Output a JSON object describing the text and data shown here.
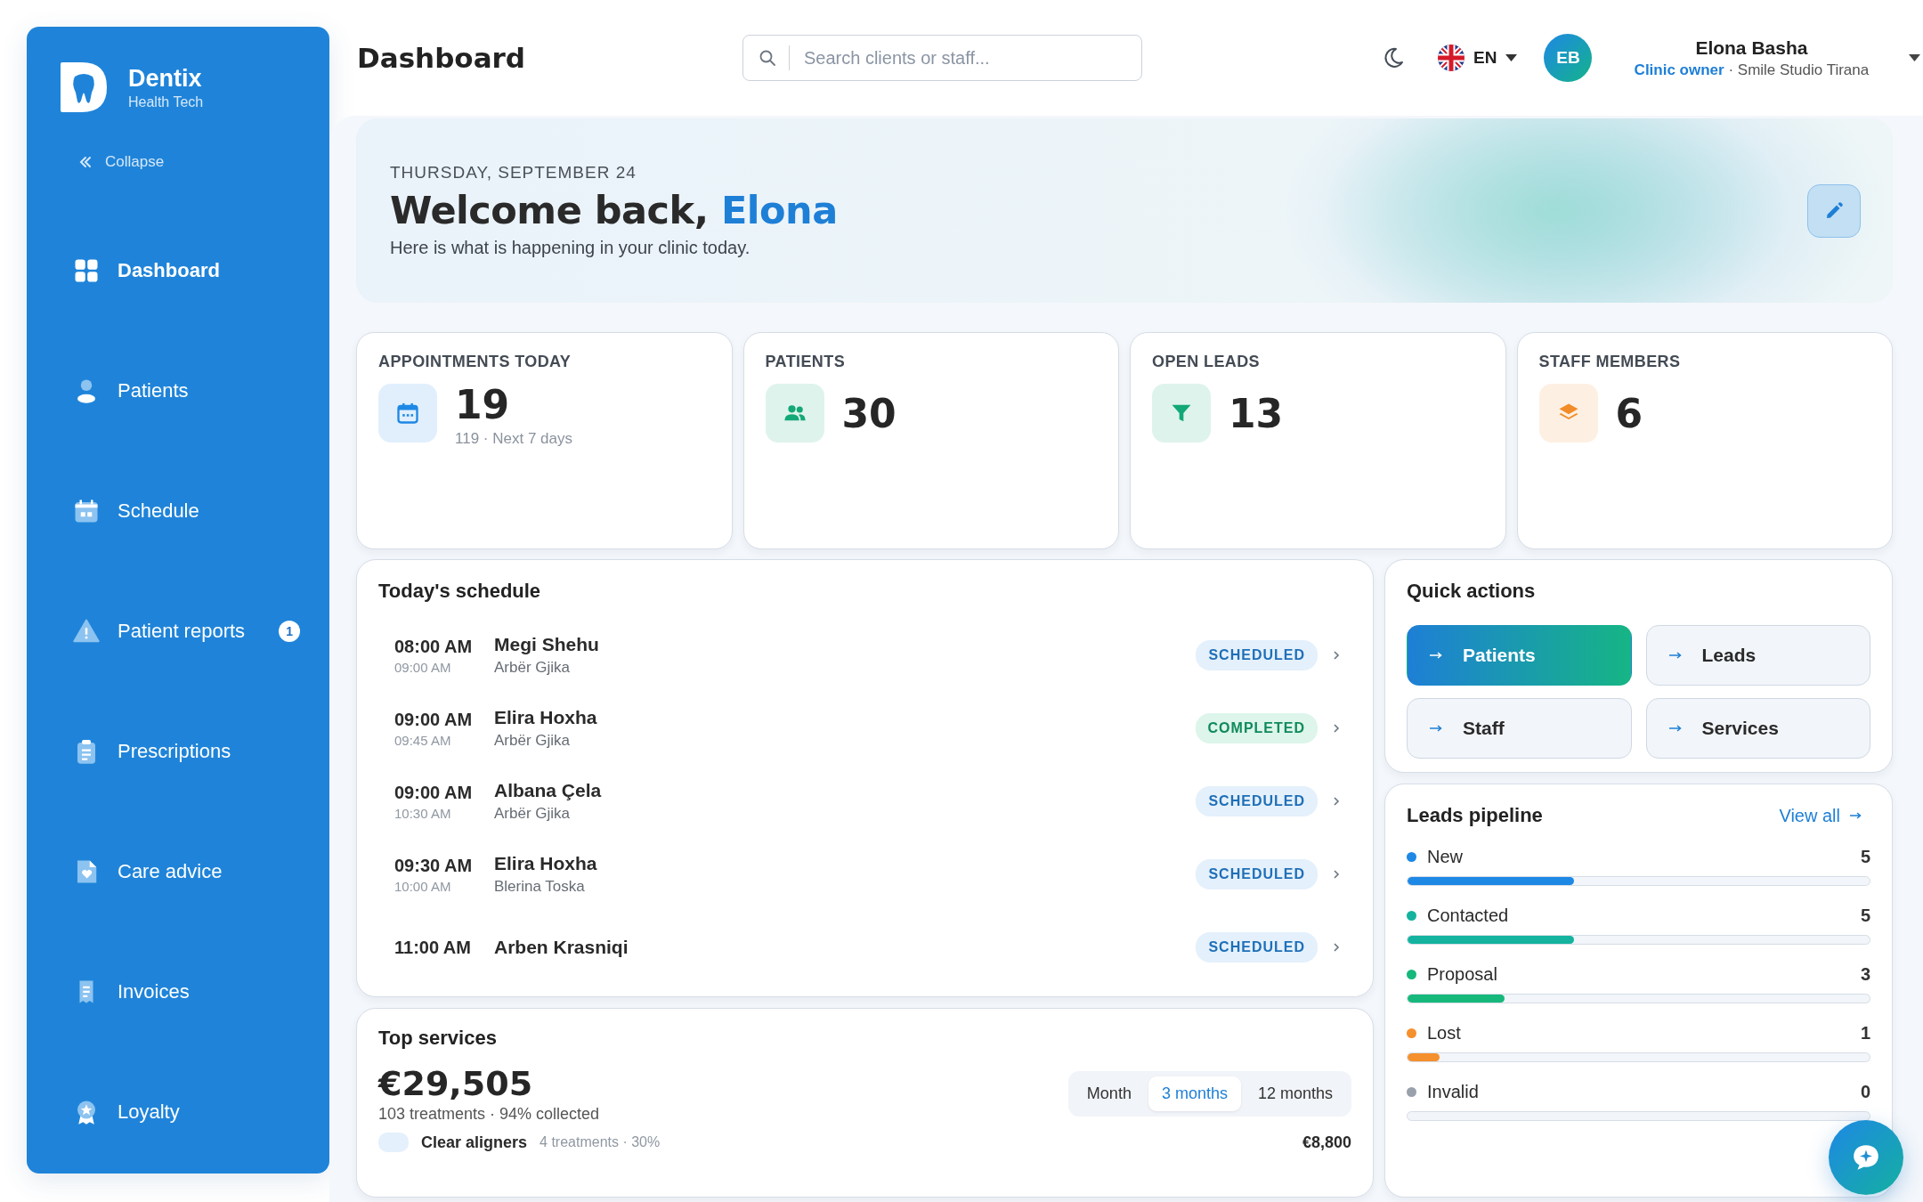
{
  "sidebar": {
    "brand": {
      "name": "Dentix",
      "tagline": "Health Tech"
    },
    "collapse": "Collapse",
    "items": [
      {
        "label": "Dashboard",
        "kind": "grid",
        "selected": true
      },
      {
        "label": "Patients",
        "kind": "person",
        "selected": false
      },
      {
        "label": "Schedule",
        "kind": "calendar",
        "selected": false
      },
      {
        "label": "Patient reports",
        "kind": "warning",
        "selected": false,
        "badge": "1"
      },
      {
        "label": "Prescriptions",
        "kind": "clipboard",
        "selected": false
      },
      {
        "label": "Care advice",
        "kind": "document",
        "selected": false
      },
      {
        "label": "Invoices",
        "kind": "receipt",
        "selected": false
      },
      {
        "label": "Loyalty",
        "kind": "award",
        "selected": false
      }
    ]
  },
  "header": {
    "title": "Dashboard",
    "search": {
      "placeholder": "Search clients or staff..."
    },
    "language": "EN",
    "user": {
      "initials": "EB",
      "name": "Elona Basha",
      "subtitle": "**Clinic owner** · Smile Studio Tirana"
    }
  },
  "hero": {
    "date": "THURSDAY, SEPTEMBER 24",
    "greeting": "Welcome back, *Elona*",
    "text": "Here is what is happening in your clinic today."
  },
  "stats": [
    {
      "label": "APPOINTMENTS TODAY",
      "value": "19",
      "sub": "119 · Next 7 days",
      "kind": "calendar",
      "color": "#1e88e5"
    },
    {
      "label": "PATIENTS",
      "value": "30",
      "kind": "people",
      "color": "#12a877"
    },
    {
      "label": "OPEN LEADS",
      "value": "13",
      "kind": "filter",
      "color": "#12a877"
    },
    {
      "label": "STAFF MEMBERS",
      "value": "6",
      "kind": "layers",
      "color": "#f28c28"
    }
  ],
  "schedule": {
    "title": "Today's schedule",
    "rows": [
      {
        "time": "08:00 AM",
        "end": "09:00 AM",
        "patient": "Megi Shehu",
        "doctor": "Arbër Gjika",
        "status": "SCHEDULED",
        "kind": "scheduled"
      },
      {
        "time": "09:00 AM",
        "end": "09:45 AM",
        "patient": "Elira Hoxha",
        "doctor": "Arbër Gjika",
        "status": "COMPLETED",
        "kind": "completed"
      },
      {
        "time": "09:00 AM",
        "end": "10:30 AM",
        "patient": "Albana Çela",
        "doctor": "Arbër Gjika",
        "status": "SCHEDULED",
        "kind": "scheduled"
      },
      {
        "time": "09:30 AM",
        "end": "10:00 AM",
        "patient": "Elira Hoxha",
        "doctor": "Blerina Toska",
        "status": "SCHEDULED",
        "kind": "scheduled"
      },
      {
        "time": "11:00 AM",
        "patient": "Arben Krasniqi",
        "status": "SCHEDULED",
        "kind": "scheduled"
      }
    ]
  },
  "top_services": {
    "title": "Top services",
    "total": "€29,505",
    "summary": "103 treatments · 94% collected",
    "periods": [
      {
        "label": "Month",
        "selected": false
      },
      {
        "label": "3 months",
        "selected": true
      },
      {
        "label": "12 months",
        "selected": false
      }
    ],
    "services": [
      {
        "name": "Clear aligners",
        "detail": "4 treatments · 30%",
        "amount": "€8,800"
      }
    ]
  },
  "quick_actions": {
    "title": "Quick actions",
    "items": [
      {
        "label": "Patients",
        "selected": true
      },
      {
        "label": "Leads",
        "selected": false
      },
      {
        "label": "Staff",
        "selected": false
      },
      {
        "label": "Services",
        "selected": false
      }
    ]
  },
  "leads_pipeline": {
    "title": "Leads pipeline",
    "link": "View all",
    "stages": [
      {
        "label": "New",
        "count": "5",
        "color": "#1e88e5",
        "level": 0.36
      },
      {
        "label": "Contacted",
        "count": "5",
        "color": "#14b3a0",
        "level": 0.36
      },
      {
        "label": "Proposal",
        "count": "3",
        "color": "#16b87c",
        "level": 0.21
      },
      {
        "label": "Lost",
        "count": "1",
        "color": "#f5902e",
        "level": 0.07
      },
      {
        "label": "Invalid",
        "count": "0",
        "color": "#9aa1ad"
      }
    ]
  }
}
